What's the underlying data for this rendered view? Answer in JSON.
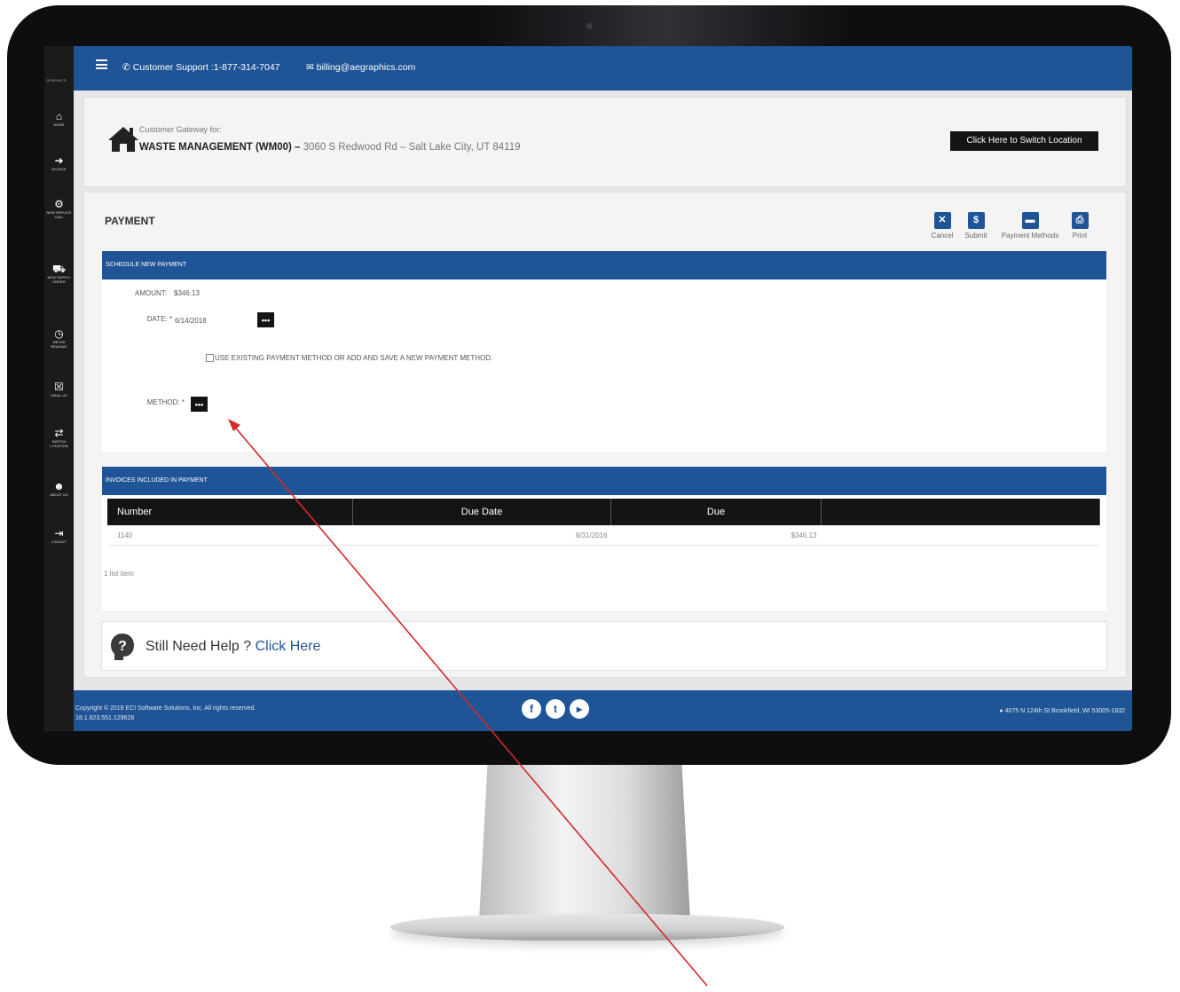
{
  "topbar": {
    "support_text": "Customer Support :1-877-314-7047",
    "email_text": "billing@aegraphics.com"
  },
  "sidebar": {
    "brand": "GRAPHICS",
    "items": [
      {
        "icon": "home-icon",
        "label": "HOME"
      },
      {
        "icon": "invoice-icon",
        "label": "INVOICE"
      },
      {
        "icon": "service-call-icon",
        "label": "NEW SERVICE CALL"
      },
      {
        "icon": "supply-order-icon",
        "label": "NEW SUPPLY ORDER"
      },
      {
        "icon": "meter-reading-icon",
        "label": "METER READING"
      },
      {
        "icon": "email-us-icon",
        "label": "EMAIL US"
      },
      {
        "icon": "switch-location-icon",
        "label": "SWITCH LOCATION"
      },
      {
        "icon": "about-us-icon",
        "label": "ABOUT US"
      },
      {
        "icon": "logout-icon",
        "label": "LOGOUT"
      }
    ]
  },
  "location": {
    "label": "Customer Gateway for:",
    "name": "WASTE MANAGEMENT (WM00) –",
    "address": "3060 S Redwood Rd – Salt Lake City, UT 84119",
    "switch_button": "Click Here to Switch Location"
  },
  "payment": {
    "title": "PAYMENT",
    "toolbar": [
      {
        "glyph": "✕",
        "label": "Cancel"
      },
      {
        "glyph": "$",
        "label": "Submit"
      },
      {
        "glyph": "▬",
        "label": "Payment Methods"
      },
      {
        "glyph": "⎙",
        "label": "Print"
      }
    ],
    "schedule_header": "SCHEDULE NEW PAYMENT",
    "amount_label": "AMOUNT:",
    "amount_value": "$346.13",
    "date_label": "DATE: *",
    "date_value": "6/14/2018",
    "checkbox_text": "USE EXISTING PAYMENT METHOD OR ADD AND SAVE A NEW PAYMENT METHOD.",
    "method_label": "METHOD: *",
    "dots": "•••"
  },
  "invoices": {
    "header": "INVOICES INCLUDED IN PAYMENT",
    "columns": [
      "Number",
      "Due Date",
      "Due",
      ""
    ],
    "rows": [
      {
        "number": "1140",
        "due_date": "8/31/2016",
        "due": "$346.13"
      }
    ],
    "count": "1 list item"
  },
  "help": {
    "text": "Still Need Help ?",
    "link": "Click Here"
  },
  "footer": {
    "copyright": "Copyright © 2018 ECI Software Solutions, Inc. All rights reserved.",
    "version": "18.1.823.551.129628",
    "address": "4075 N 124th St Brookfield, WI 53005-1832",
    "social": [
      {
        "icon": "facebook-icon",
        "glyph": "f"
      },
      {
        "icon": "twitter-icon",
        "glyph": "t"
      },
      {
        "icon": "youtube-icon",
        "glyph": "▸"
      }
    ]
  },
  "colors": {
    "brand_blue": "#1f5496",
    "annotation_red": "#d32a2a",
    "bezel": "#0e0e10"
  }
}
